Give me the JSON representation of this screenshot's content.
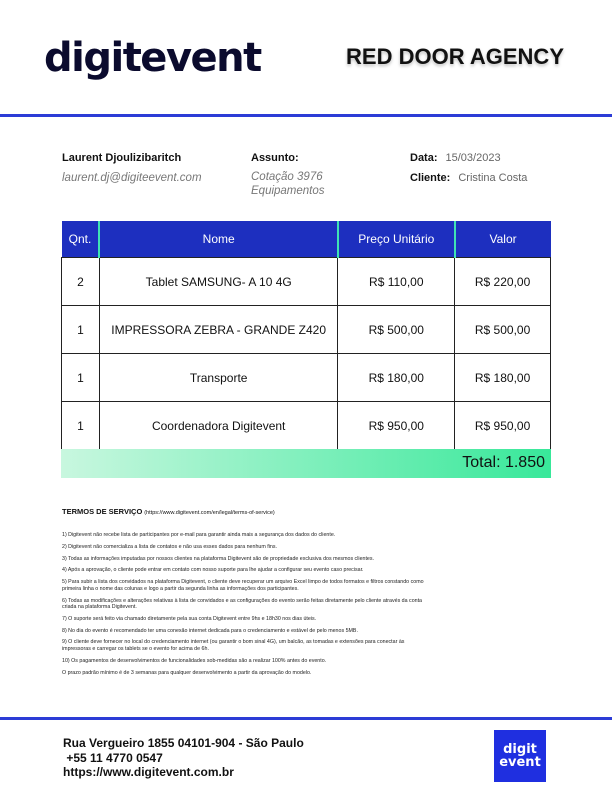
{
  "header": {
    "logo_text": "digitevent",
    "client": "RED DOOR AGENCY"
  },
  "contact": {
    "name": "Laurent Djoulizibaritch",
    "email": "laurent.dj@digiteevent.com"
  },
  "subject": {
    "label": "Assunto:",
    "line1": "Cotação 3976",
    "line2": "Equipamentos"
  },
  "meta": {
    "date_label": "Data:",
    "date_value": "15/03/2023",
    "client_label": "Cliente:",
    "client_value": "Cristina Costa"
  },
  "table": {
    "headers": [
      "Qnt.",
      "Nome",
      "Preço Unitário",
      "Valor"
    ],
    "rows": [
      {
        "qty": "2",
        "name": "Tablet SAMSUNG- A 10 4G",
        "unit": "R$ 110,00",
        "value": "R$ 220,00"
      },
      {
        "qty": "1",
        "name": "IMPRESSORA ZEBRA - GRANDE Z420",
        "unit": "R$ 500,00",
        "value": "R$ 500,00"
      },
      {
        "qty": "1",
        "name": "Transporte",
        "unit": "R$ 180,00",
        "value": "R$ 180,00"
      },
      {
        "qty": "1",
        "name": "Coordenadora Digitevent",
        "unit": "R$ 950,00",
        "value": "R$ 950,00"
      }
    ],
    "total": "Total: 1.850"
  },
  "terms": {
    "title": "TERMOS DE SERVIÇO",
    "url": "(https://www.digitevent.com/en/legal/terms-of-service)",
    "items": [
      "1) Digitevent não recebe lista de participantes por e-mail para garantir ainda mais a segurança dos dados do cliente.",
      "2) Digitevent não comercializa a lista de contatos e não usa esses dados para nenhum fins.",
      "3) Todas as informações imputadas por nossos clientes na plataforma Digitevent são de propriedade exclusiva dos mesmos clientes.",
      "4) Após a aprovação, o cliente pode entrar em contato com nosso suporte para lhe ajudar a configurar seu evento caso precisar.",
      "5) Para subir a lista dos convidados na plataforma Digitevent, o cliente deve recuperar um arquivo Excel limpo de todos formatos e filtros constando como primeira linha o nome das colunas e logo a partir da segunda linha as informações dos participantes.",
      "6) Todas as modificações e alterações relativas à lista de convidados e as configurações do evento serão feitas diretamente pelo cliente através da conta criada na plataforma Digitevent.",
      "7) O suporte será feito via chamado diretamente pela sua conta Digitevent entre 9hs e 18h30 nos dias úteis.",
      "8) No dia do evento é recomendado ter uma conexão internet dedicada para o credenciamento e estável de pelo menos 5MB.",
      "9) O cliente deve fornecer no local do credenciamento internet (ou garantir o bom sinal 4G), um balcão, as tomadas e extensões para conectar às impressoras e carregar os tablets se o evento for acima de 6h.",
      "10) Os pagamentos de desenvolvimentos de funcionalidades sob-medidas são a realizar 100% antes do evento.",
      "O prazo padrão mínimo é de 3 semanas para qualquer desenvolvimento a partir da aprovação do modelo."
    ]
  },
  "footer": {
    "address": "Rua Vergueiro 1855 04101-904 - São Paulo",
    "phone": " +55 11 4770 0547",
    "website": "https://www.digitevent.com.br",
    "badge_line1": "digit",
    "badge_line2": "event"
  },
  "colors": {
    "brand_blue": "#1d2fbf",
    "accent_green": "#38e89a",
    "logo_navy": "#0b0b2e"
  }
}
